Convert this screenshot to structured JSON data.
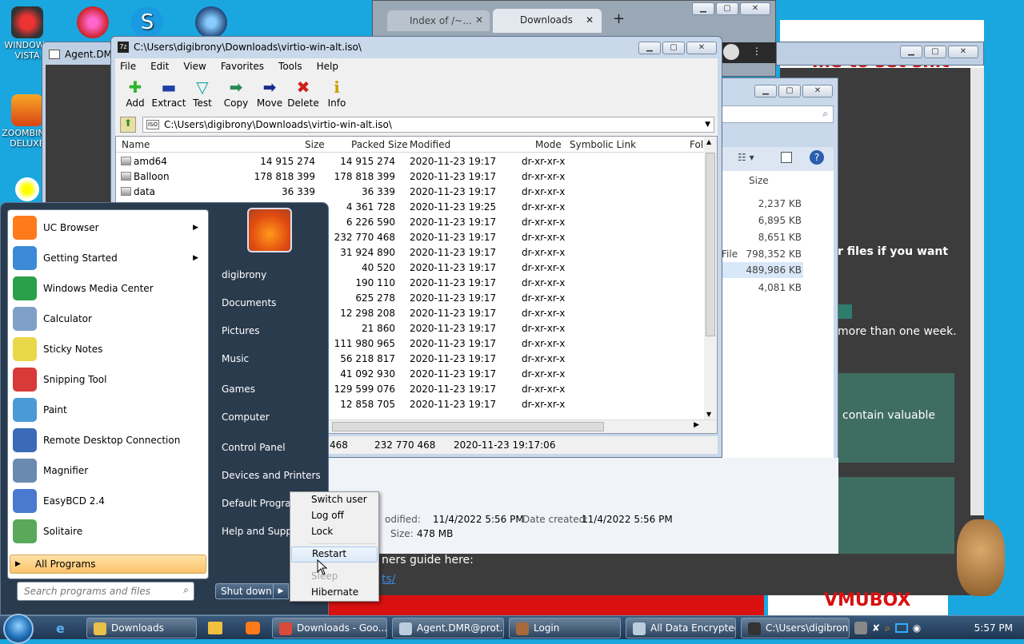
{
  "desktop": {
    "icons": [
      {
        "label": "WINDOWS VISTA"
      },
      {
        "label": "ZOOMBINIS DELUXE"
      }
    ]
  },
  "browser": {
    "tabs": [
      {
        "label": "Index of /~..."
      },
      {
        "label": "Downloads"
      }
    ],
    "new_tab": "+"
  },
  "agent_window": {
    "title": "Agent.DM"
  },
  "zip": {
    "title": "C:\\Users\\digibrony\\Downloads\\virtio-win-alt.iso\\",
    "menu": [
      "File",
      "Edit",
      "View",
      "Favorites",
      "Tools",
      "Help"
    ],
    "toolbar": [
      {
        "label": "Add",
        "icon": "add-icon",
        "glyph": "✚",
        "color": "#2db52d"
      },
      {
        "label": "Extract",
        "icon": "extract-icon",
        "glyph": "▬",
        "color": "#1f3fa8"
      },
      {
        "label": "Test",
        "icon": "test-icon",
        "glyph": "▽",
        "color": "#19a3a3"
      },
      {
        "label": "Copy",
        "icon": "copy-icon",
        "glyph": "➡",
        "color": "#2a8a56"
      },
      {
        "label": "Move",
        "icon": "move-icon",
        "glyph": "➡",
        "color": "#1a2a90"
      },
      {
        "label": "Delete",
        "icon": "delete-icon",
        "glyph": "✖",
        "color": "#d21d1d"
      },
      {
        "label": "Info",
        "icon": "info-icon",
        "glyph": "i",
        "color": "#c9a000"
      }
    ],
    "address": "C:\\Users\\digibrony\\Downloads\\virtio-win-alt.iso\\",
    "columns": [
      "Name",
      "Size",
      "Packed Size",
      "Modified",
      "Mode",
      "Symbolic Link",
      "Fol"
    ],
    "rows": [
      {
        "name": "amd64",
        "size": "14 915 274",
        "packed": "14 915 274",
        "modified": "2020-11-23 19:17",
        "mode": "dr-xr-xr-x"
      },
      {
        "name": "Balloon",
        "size": "178 818 399",
        "packed": "178 818 399",
        "modified": "2020-11-23 19:17",
        "mode": "dr-xr-xr-x"
      },
      {
        "name": "data",
        "size": "36 339",
        "packed": "36 339",
        "modified": "2020-11-23 19:17",
        "mode": "dr-xr-xr-x"
      },
      {
        "name": "",
        "size": "",
        "packed": "4 361 728",
        "modified": "2020-11-23 19:25",
        "mode": "dr-xr-xr-x"
      },
      {
        "name": "",
        "size": "",
        "packed": "6 226 590",
        "modified": "2020-11-23 19:17",
        "mode": "dr-xr-xr-x"
      },
      {
        "name": "",
        "size": "",
        "packed": "232 770 468",
        "modified": "2020-11-23 19:17",
        "mode": "dr-xr-xr-x"
      },
      {
        "name": "",
        "size": "",
        "packed": "31 924 890",
        "modified": "2020-11-23 19:17",
        "mode": "dr-xr-xr-x"
      },
      {
        "name": "",
        "size": "",
        "packed": "40 520",
        "modified": "2020-11-23 19:17",
        "mode": "dr-xr-xr-x"
      },
      {
        "name": "",
        "size": "",
        "packed": "190 110",
        "modified": "2020-11-23 19:17",
        "mode": "dr-xr-xr-x"
      },
      {
        "name": "",
        "size": "",
        "packed": "625 278",
        "modified": "2020-11-23 19:17",
        "mode": "dr-xr-xr-x"
      },
      {
        "name": "",
        "size": "",
        "packed": "12 298 208",
        "modified": "2020-11-23 19:17",
        "mode": "dr-xr-xr-x"
      },
      {
        "name": "",
        "size": "",
        "packed": "21 860",
        "modified": "2020-11-23 19:17",
        "mode": "dr-xr-xr-x"
      },
      {
        "name": "",
        "size": "",
        "packed": "111 980 965",
        "modified": "2020-11-23 19:17",
        "mode": "dr-xr-xr-x"
      },
      {
        "name": "",
        "size": "",
        "packed": "56 218 817",
        "modified": "2020-11-23 19:17",
        "mode": "dr-xr-xr-x"
      },
      {
        "name": "",
        "size": "",
        "packed": "41 092 930",
        "modified": "2020-11-23 19:17",
        "mode": "dr-xr-xr-x"
      },
      {
        "name": "",
        "size": "",
        "packed": "129 599 076",
        "modified": "2020-11-23 19:17",
        "mode": "dr-xr-xr-x"
      },
      {
        "name": "",
        "size": "",
        "packed": "12 858 705",
        "modified": "2020-11-23 19:17",
        "mode": "dr-xr-xr-x"
      }
    ],
    "status": {
      "size": "468",
      "packed": "232 770 468",
      "modified": "2020-11-23 19:17:06"
    }
  },
  "explorer": {
    "size_header": "Size",
    "sizes": [
      "2,237 KB",
      "6,895 KB",
      "8,651 KB",
      "798,352 KB",
      "489,986 KB",
      "4,081 KB"
    ],
    "file_label": "File",
    "details": {
      "modified_label": "odified:",
      "modified": "11/4/2022 5:56 PM",
      "created_label": "Date created:",
      "created": "11/4/2022 5:56 PM",
      "size_label": "Size:",
      "size": "478 MB"
    }
  },
  "web": {
    "heading": "me to set shit",
    "line1": "r files if you want",
    "line2": "more than one week.",
    "line3": "contain valuable",
    "guide": "ners guide here:",
    "link": "ts/",
    "banner": "VMUBOX"
  },
  "start_menu": {
    "programs": [
      {
        "label": "UC Browser",
        "icon": "uc-browser-icon",
        "color": "#ff7a1a",
        "arrow": true
      },
      {
        "label": "Getting Started",
        "icon": "getting-started-icon",
        "color": "#3a8ad8",
        "arrow": true
      },
      {
        "label": "Windows Media Center",
        "icon": "windows-media-center-icon",
        "color": "#2aa04a",
        "arrow": false
      },
      {
        "label": "Calculator",
        "icon": "calculator-icon",
        "color": "#7fa0c8",
        "arrow": false
      },
      {
        "label": "Sticky Notes",
        "icon": "sticky-notes-icon",
        "color": "#e8d84a",
        "arrow": false
      },
      {
        "label": "Snipping Tool",
        "icon": "snipping-tool-icon",
        "color": "#d83a3a",
        "arrow": false
      },
      {
        "label": "Paint",
        "icon": "paint-icon",
        "color": "#4a9ad8",
        "arrow": false
      },
      {
        "label": "Remote Desktop Connection",
        "icon": "remote-desktop-icon",
        "color": "#3a6ab8",
        "arrow": false
      },
      {
        "label": "Magnifier",
        "icon": "magnifier-icon",
        "color": "#6a8ab0",
        "arrow": false
      },
      {
        "label": "EasyBCD 2.4",
        "icon": "easybcd-icon",
        "color": "#4a7ad0",
        "arrow": false
      },
      {
        "label": "Solitaire",
        "icon": "solitaire-icon",
        "color": "#5aa85a",
        "arrow": false
      }
    ],
    "all_programs": "All Programs",
    "search_placeholder": "Search programs and files",
    "right": [
      "digibrony",
      "Documents",
      "Pictures",
      "Music",
      "Games",
      "Computer",
      "Control Panel",
      "Devices and Printers",
      "Default Programs",
      "Help and Support"
    ],
    "shutdown": "Shut down"
  },
  "context_menu": {
    "items": [
      {
        "label": "Switch user",
        "state": "normal"
      },
      {
        "label": "Log off",
        "state": "normal"
      },
      {
        "label": "Lock",
        "state": "normal"
      },
      {
        "label": "Restart",
        "state": "hover"
      },
      {
        "label": "Sleep",
        "state": "disabled"
      },
      {
        "label": "Hibernate",
        "state": "normal"
      }
    ]
  },
  "taskbar": {
    "buttons": [
      {
        "label": "Downloads",
        "icon": "folder-icon",
        "color": "#e8c04a"
      },
      {
        "label": "Downloads - Goo...",
        "icon": "chrome-icon",
        "color": "#d84a3a"
      },
      {
        "label": "Agent.DMR@prot...",
        "icon": "window-icon",
        "color": "#bcd"
      },
      {
        "label": "Login",
        "icon": "login-icon",
        "color": "#a86a3a"
      },
      {
        "label": "All Data Encrypted",
        "icon": "window-icon",
        "color": "#bcd"
      },
      {
        "label": "C:\\Users\\digibron...",
        "icon": "7zip-icon",
        "color": "#333"
      }
    ],
    "clock": "5:57 PM"
  }
}
